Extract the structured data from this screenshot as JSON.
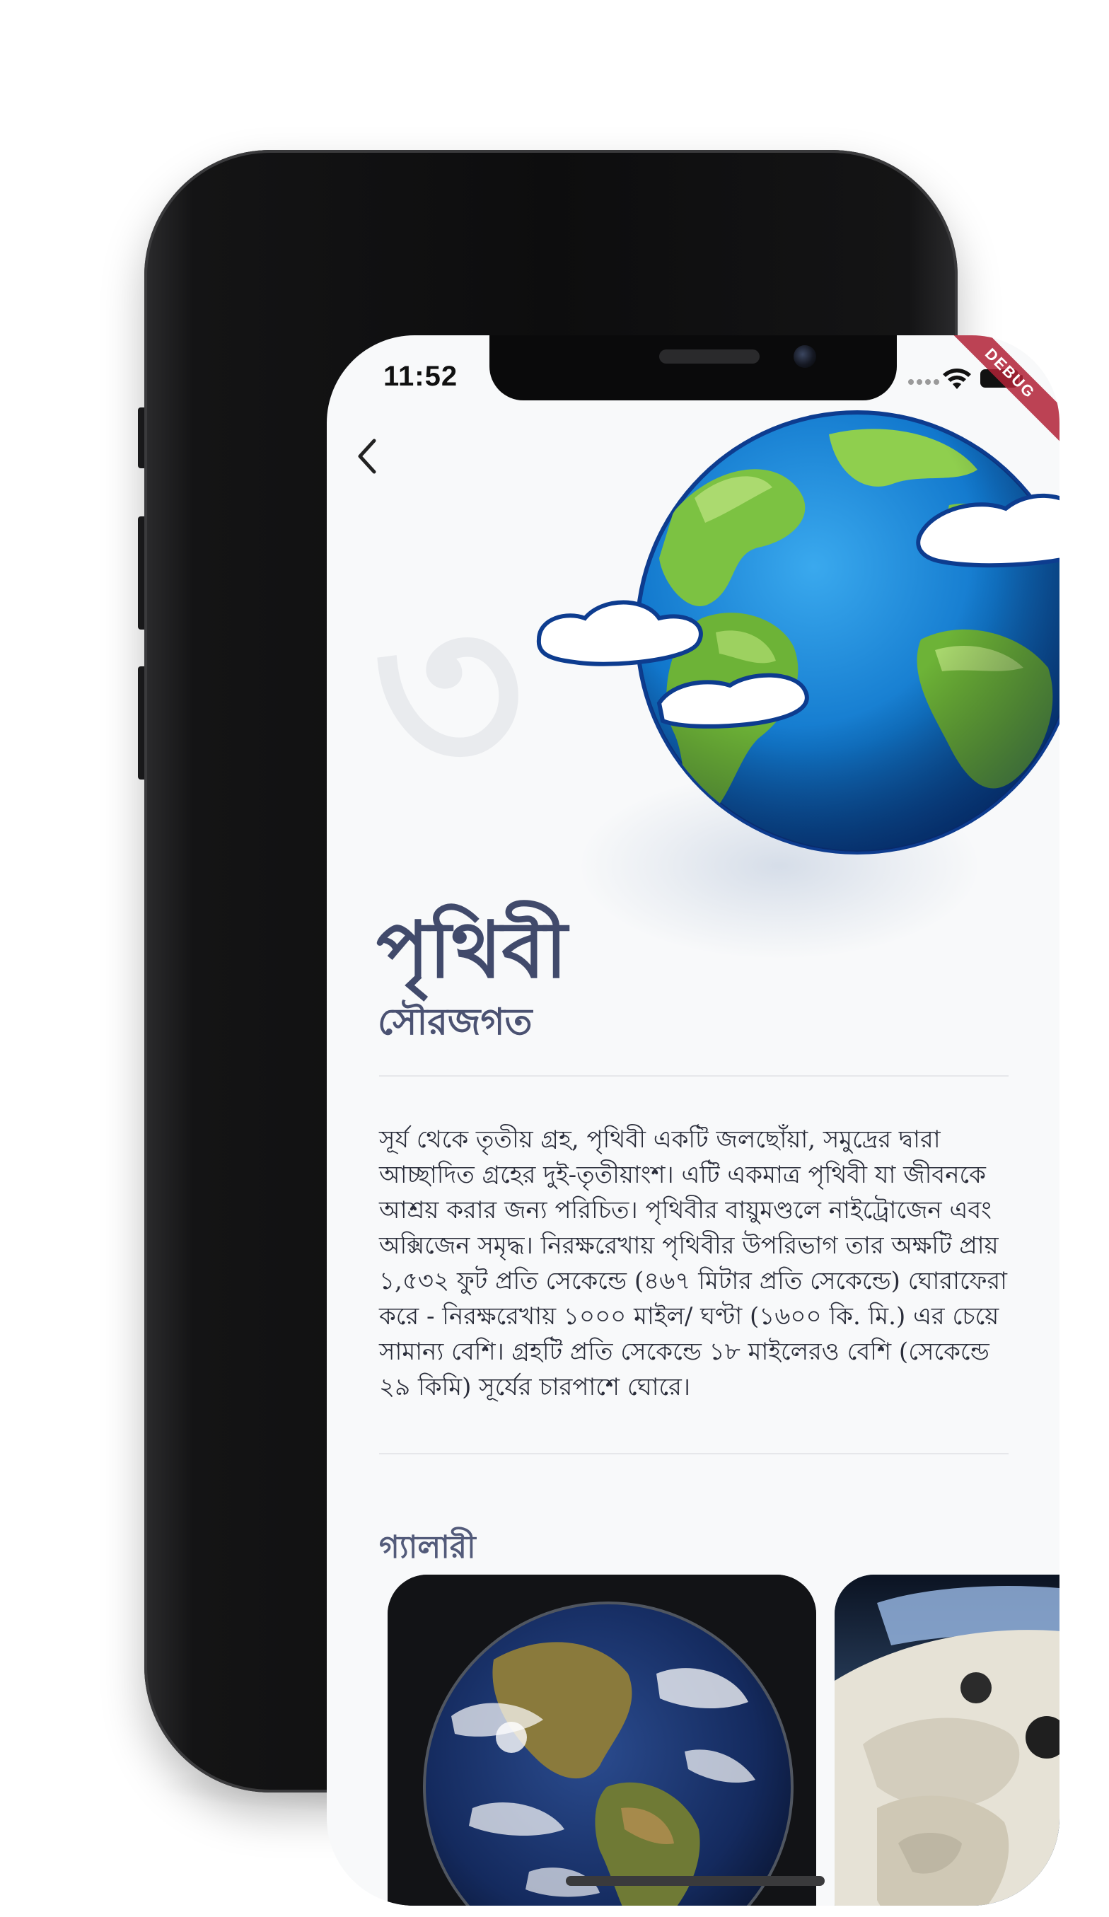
{
  "status_bar": {
    "time": "11:52",
    "debug_banner": "DEBUG"
  },
  "header": {
    "back_icon": "chevron-left-icon"
  },
  "planet": {
    "number": "৩",
    "name": "পৃথিবী",
    "category": "সৌরজগত",
    "description": "সূর্য থেকে তৃতীয় গ্রহ, পৃথিবী একটি জলছোঁয়া, সমুদ্রের দ্বারা আচ্ছাদিত গ্রহের দুই-তৃতীয়াংশ। এটি একমাত্র পৃথিবী যা জীবনকে আশ্রয় করার জন্য পরিচিত। পৃথিবীর বায়ুমণ্ডলে নাইট্রোজেন এবং অক্সিজেন সমৃদ্ধ। নিরক্ষরেখায় পৃথিবীর উপরিভাগ তার অক্ষটি প্রায় ১,৫৩২ ফুট প্রতি সেকেন্ডে (৪৬৭ মিটার প্রতি সেকেন্ডে) ঘোরাফেরা করে - নিরক্ষরেখায় ১০০০ মাইল/ ঘণ্টা (১৬০০ কি. মি.) এর চেয়ে সামান্য বেশি। গ্রহটি প্রতি সেকেন্ডে ১৮ মাইলেরও বেশি (সেকেন্ডে ২৯ কিমি) সূর্যের চারপাশে ঘোরে।"
  },
  "gallery": {
    "label": "গ্যালারী",
    "items": [
      {
        "name": "earth-from-space-photo"
      },
      {
        "name": "astronaut-photo"
      }
    ]
  },
  "colors": {
    "title": "#414a6b",
    "background": "#f8f9fa",
    "ocean": "#1e7fd6",
    "land": "#7cc242"
  }
}
